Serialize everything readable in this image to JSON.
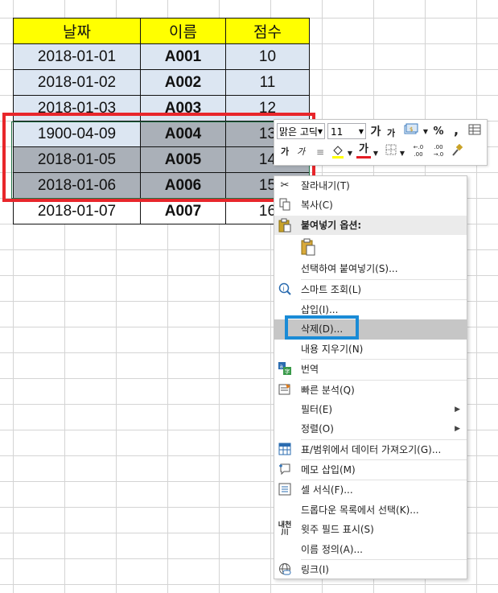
{
  "table": {
    "headers": [
      "날짜",
      "이름",
      "점수"
    ],
    "rows": [
      [
        "2018-01-01",
        "A001",
        "10"
      ],
      [
        "2018-01-02",
        "A002",
        "11"
      ],
      [
        "2018-01-03",
        "A003",
        "12"
      ],
      [
        "1900-04-09",
        "A004",
        "13"
      ],
      [
        "2018-01-05",
        "A005",
        "14"
      ],
      [
        "2018-01-06",
        "A006",
        "15"
      ],
      [
        "2018-01-07",
        "A007",
        "16"
      ]
    ]
  },
  "mini_toolbar": {
    "font_name": "맑은 고딕",
    "font_size": "11",
    "grow_font": "가",
    "shrink_font": "가",
    "percent": "%",
    "comma": ",",
    "bold": "가",
    "italic": "가",
    "font_color": "가",
    "inc_decimal": "←.0 .00",
    "dec_decimal": ".00 →.0"
  },
  "context_menu": {
    "cut": "잘라내기(T)",
    "copy": "복사(C)",
    "paste_options": "붙여넣기 옵션:",
    "paste_special": "선택하여 붙여넣기(S)...",
    "smart_lookup": "스마트 조회(L)",
    "insert": "삽입(I)...",
    "delete": "삭제(D)...",
    "clear_contents": "내용 지우기(N)",
    "translate": "번역",
    "quick_analysis": "빠른 분석(Q)",
    "filter": "필터(E)",
    "sort": "정렬(O)",
    "get_data": "표/범위에서 데이터 가져오기(G)...",
    "insert_comment": "메모 삽입(M)",
    "format_cells": "셀 서식(F)...",
    "pick_dropdown": "드롭다운 목록에서 선택(K)...",
    "phonetic": "윗주 필드 표시(S)",
    "define_name": "이름 정의(A)...",
    "link": "링크(I)"
  },
  "colors": {
    "header_fill": "#ffff00",
    "row_fill": "#dce6f2",
    "selected_fill": "#aab0b8",
    "red_highlight": "#e8262b",
    "blue_highlight": "#1a8bd6"
  }
}
